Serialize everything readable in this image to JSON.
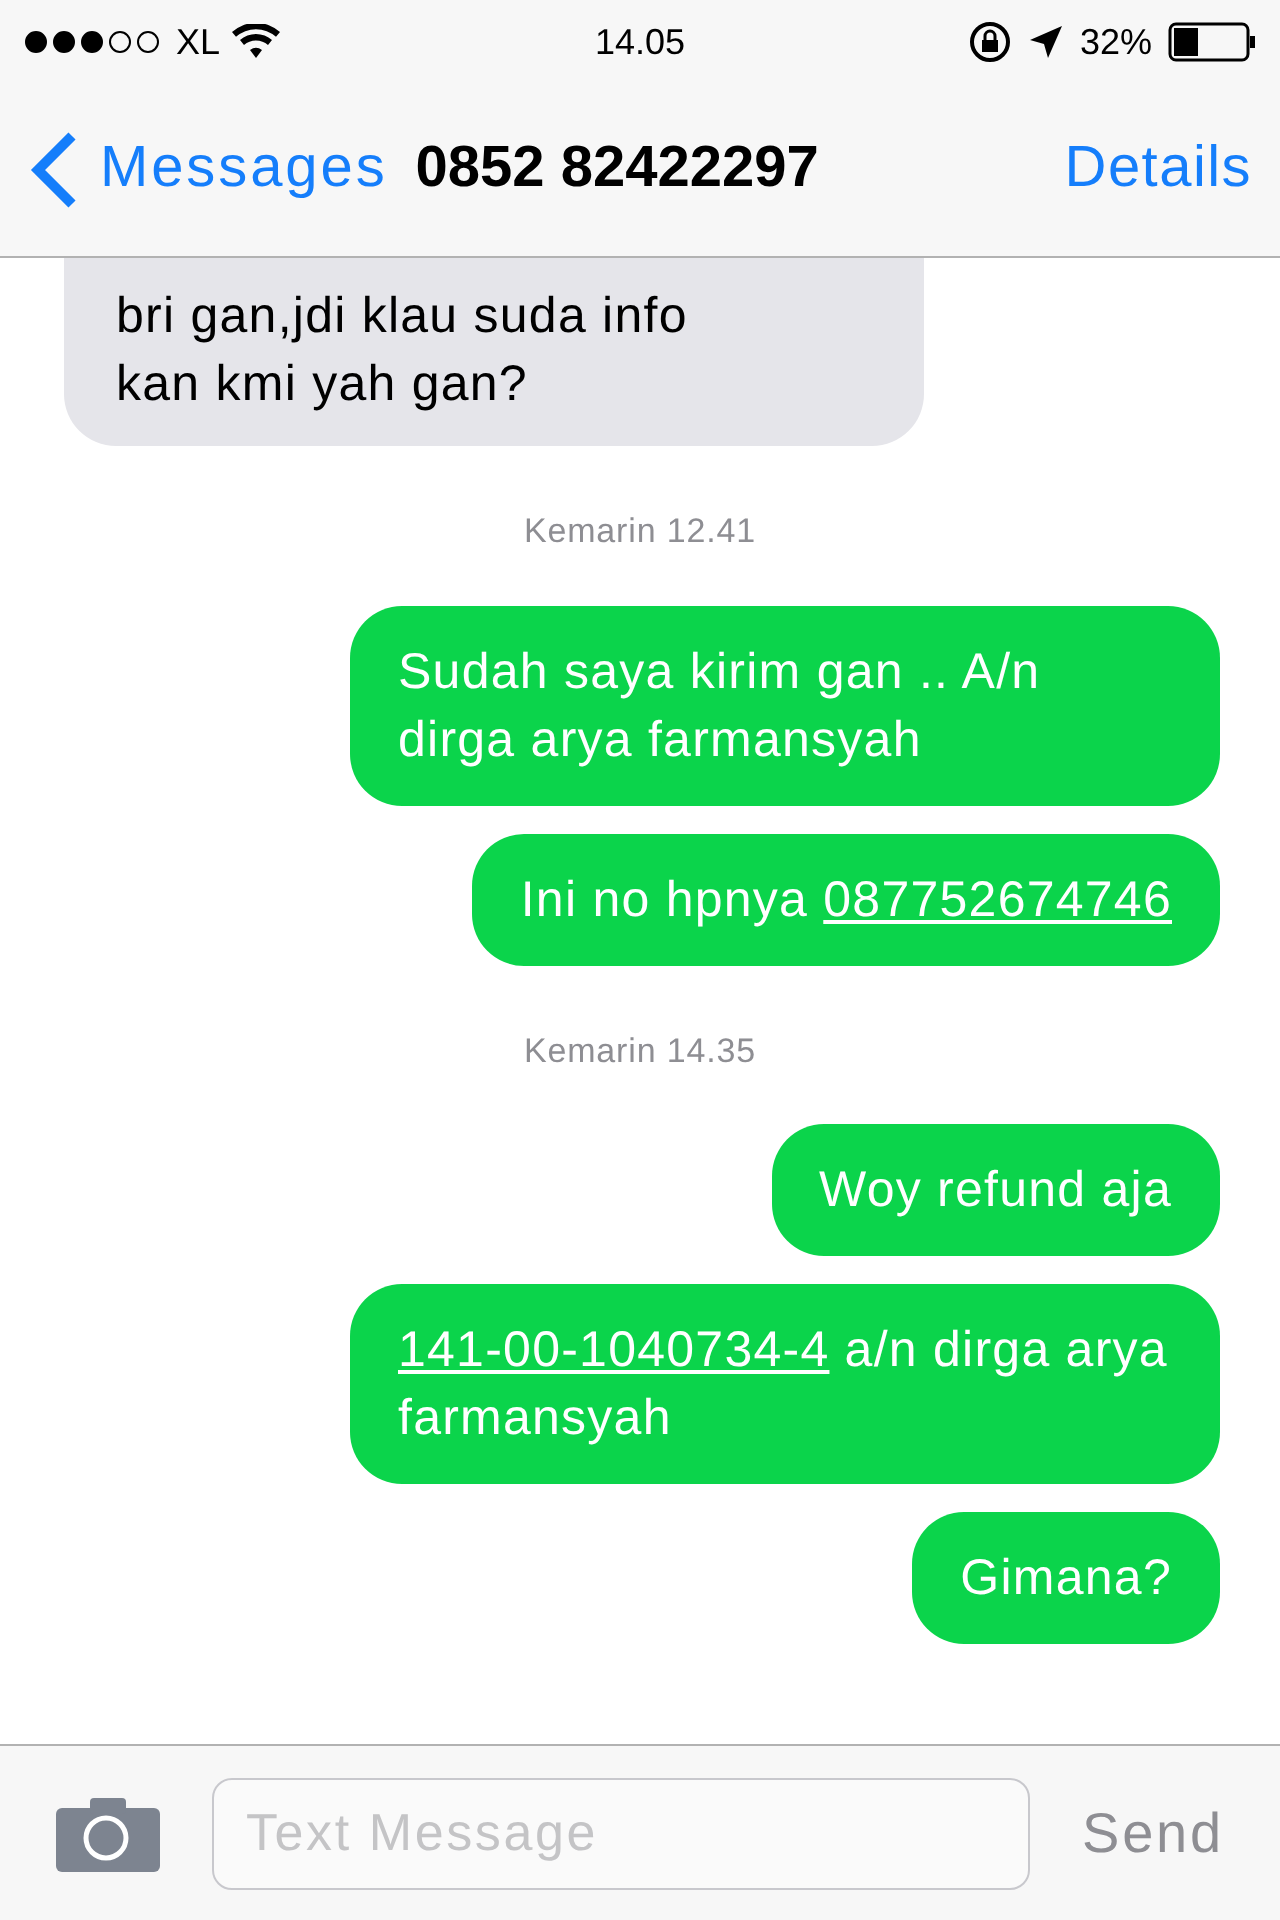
{
  "status_bar": {
    "carrier": "XL",
    "time": "14.05",
    "battery": "32%"
  },
  "nav": {
    "back": "Messages",
    "title": "0852 82422297",
    "action": "Details"
  },
  "messages": [
    {
      "kind": "received",
      "parts": [
        {
          "text": "bri gan,jdi klau suda info kan kmi yah gan?",
          "link": false
        }
      ]
    },
    {
      "kind": "timestamp",
      "parts": [
        {
          "text": "Kemarin 12.41",
          "link": false
        }
      ]
    },
    {
      "kind": "sent",
      "parts": [
        {
          "text": "Sudah saya kirim gan .. A/n dirga arya farmansyah",
          "link": false
        }
      ]
    },
    {
      "kind": "sent",
      "parts": [
        {
          "text": "Ini no hpnya ",
          "link": false
        },
        {
          "text": "087752674746",
          "link": true
        }
      ]
    },
    {
      "kind": "timestamp",
      "parts": [
        {
          "text": "Kemarin 14.35",
          "link": false
        }
      ]
    },
    {
      "kind": "sent",
      "parts": [
        {
          "text": "Woy refund aja",
          "link": false
        }
      ]
    },
    {
      "kind": "sent",
      "parts": [
        {
          "text": "141-00-1040734-4",
          "link": true
        },
        {
          "text": " a/n dirga arya farmansyah",
          "link": false
        }
      ]
    },
    {
      "kind": "sent",
      "parts": [
        {
          "text": "Gimana?",
          "link": false
        }
      ]
    }
  ],
  "composer": {
    "placeholder": "Text Message",
    "send": "Send"
  }
}
